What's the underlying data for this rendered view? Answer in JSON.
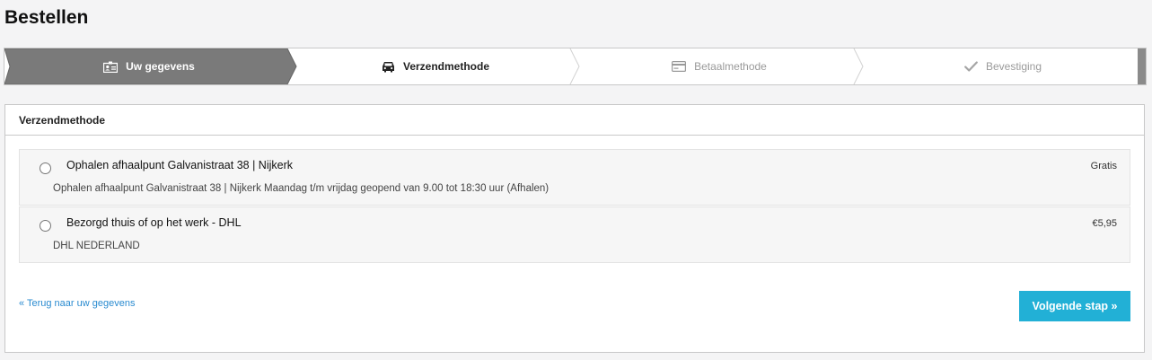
{
  "page": {
    "title": "Bestellen"
  },
  "steps": [
    {
      "label": "Uw gegevens",
      "icon": "id-card-icon",
      "state": "completed"
    },
    {
      "label": "Verzendmethode",
      "icon": "car-icon",
      "state": "active"
    },
    {
      "label": "Betaalmethode",
      "icon": "credit-card-icon",
      "state": "upcoming"
    },
    {
      "label": "Bevestiging",
      "icon": "check-icon",
      "state": "upcoming"
    }
  ],
  "shipping": {
    "heading": "Verzendmethode",
    "options": [
      {
        "title": "Ophalen afhaalpunt Galvanistraat 38 | Nijkerk",
        "price": "Gratis",
        "description": "Ophalen afhaalpunt Galvanistraat 38 | Nijkerk Maandag t/m vrijdag geopend van 9.00 tot 18:30 uur (Afhalen)",
        "selected": false
      },
      {
        "title": "Bezorgd thuis of op het werk - DHL",
        "price": "€5,95",
        "description": "DHL NEDERLAND",
        "selected": false
      }
    ]
  },
  "actions": {
    "back_label": "« Terug naar uw gegevens",
    "next_label": "Volgende stap »"
  },
  "colors": {
    "completed_step": "#7a7a7a",
    "link": "#2a8bd0",
    "primary_button": "#22b0d6"
  }
}
